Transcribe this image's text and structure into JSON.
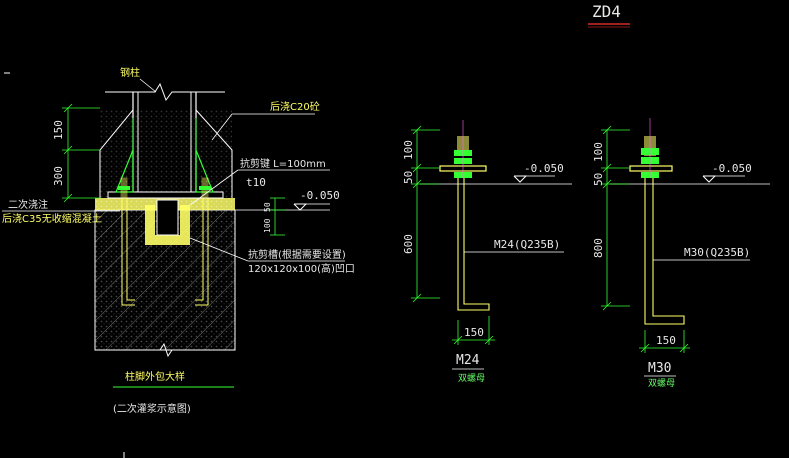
{
  "drawing": {
    "sheet_title": "ZD4",
    "colors": {
      "background": "#000000",
      "steel": "#ffffff",
      "anchor_bolt": "#ffff66",
      "grout": "#ffff66",
      "stiffener": "#33ff33",
      "dimension": "#33ff33",
      "text": "#e8e8e8",
      "title_underline": "#ff3333"
    }
  },
  "left_detail": {
    "label_column": "钢柱",
    "label_back_plate": "后浇C20砼",
    "label_shear_key": "抗剪键 L=100mm",
    "label_shear_key_thk": "t10",
    "label_level": "-0.050",
    "label_grout_1": "二次浇注",
    "label_grout_2": "后浇C35无收缩混凝土",
    "label_pocket_1": "抗剪槽(根据需要设置)",
    "label_pocket_2": "120x120x100(高)凹口",
    "dim_150": "150",
    "dim_300": "300",
    "dim_50": "50",
    "dim_100": "100",
    "caption": "柱脚外包大样",
    "note": "(二次灌浆示意图)"
  },
  "bolt_m24": {
    "dim_100": "100",
    "dim_50": "50",
    "dim_600": "600",
    "level": "-0.050",
    "spec": "M24(Q235B)",
    "hook": "150",
    "name": "M24",
    "sub": "双螺母"
  },
  "bolt_m30": {
    "dim_100": "100",
    "dim_50": "50",
    "dim_800": "800",
    "level": "-0.050",
    "spec": "M30(Q235B)",
    "hook": "150",
    "name": "M30",
    "sub": "双螺母"
  }
}
